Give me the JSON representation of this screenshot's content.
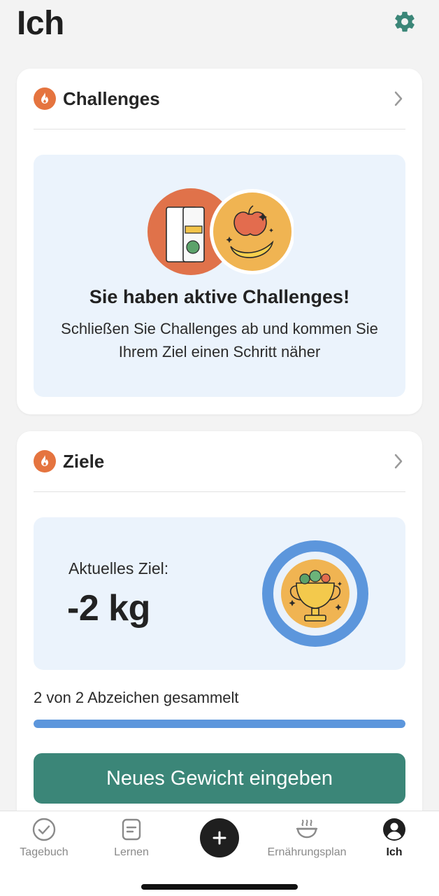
{
  "header": {
    "title": "Ich",
    "settings_icon": "gear-icon"
  },
  "colors": {
    "accent_green": "#3b8678",
    "flame_orange": "#e5743f",
    "progress_blue": "#5c96dc",
    "panel_blue": "#ebf3fc"
  },
  "challenges_card": {
    "title": "Challenges",
    "icon": "flame-icon",
    "heading": "Sie haben aktive Challenges!",
    "subtext": "Schließen Sie Challenges ab und kommen Sie Ihrem Ziel einen Schritt näher"
  },
  "goals_card": {
    "title": "Ziele",
    "icon": "flame-icon",
    "current_goal_label": "Aktuelles Ziel:",
    "current_goal_value": "-2 kg",
    "badges_text": "2 von 2 Abzeichen gesammelt",
    "badges_collected": 2,
    "badges_total": 2,
    "button_label": "Neues Gewicht eingeben"
  },
  "tabbar": {
    "tabs": [
      {
        "label": "Tagebuch",
        "icon": "check-circle-icon",
        "active": false
      },
      {
        "label": "Lernen",
        "icon": "document-icon",
        "active": false
      },
      {
        "label": "",
        "icon": "plus-icon",
        "active": false
      },
      {
        "label": "Ernährungsplan",
        "icon": "bowl-icon",
        "active": false
      },
      {
        "label": "Ich",
        "icon": "profile-icon",
        "active": true
      }
    ]
  }
}
